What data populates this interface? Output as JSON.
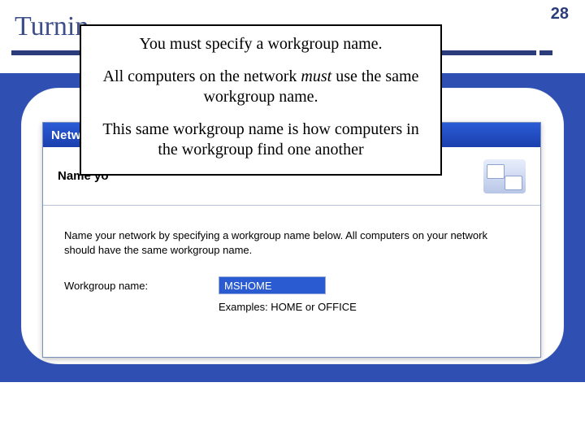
{
  "slide": {
    "title": "Turnin",
    "page_number": "28"
  },
  "callout": {
    "line1": "You must specify a workgroup name.",
    "line2_pre": "All computers on the network ",
    "line2_em": "must",
    "line2_post": " use the same workgroup name.",
    "line3": "This same workgroup name is how computers in the workgroup find one another"
  },
  "wizard": {
    "titlebar": "Networ",
    "header": "Name yo",
    "instruction": "Name your network by specifying a workgroup name below. All computers on your network should have the same workgroup name.",
    "label": "Workgroup name:",
    "value": "MSHOME",
    "examples_label": "Examples: HOME or OFFICE"
  }
}
